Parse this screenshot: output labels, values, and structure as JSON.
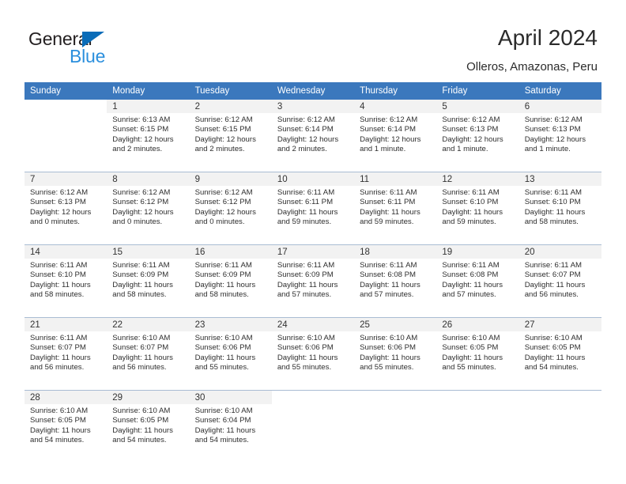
{
  "brand": {
    "name_dark": "General",
    "name_blue": "Blue",
    "triangle_color": "#0a6cb8",
    "blue_text_color": "#2b8fdd"
  },
  "header": {
    "title": "April 2024",
    "location": "Olleros, Amazonas, Peru"
  },
  "theme": {
    "header_row_bg": "#3b78bd",
    "header_row_text": "#ffffff",
    "daynum_band_bg": "#f2f2f2",
    "row_separator": "#a9bcd3"
  },
  "weekdays": [
    "Sunday",
    "Monday",
    "Tuesday",
    "Wednesday",
    "Thursday",
    "Friday",
    "Saturday"
  ],
  "labels": {
    "sunrise_prefix": "Sunrise:",
    "sunset_prefix": "Sunset:",
    "daylight_prefix": "Daylight:"
  },
  "weeks": [
    [
      {
        "day": "",
        "blank": true
      },
      {
        "day": "1",
        "sunrise": "Sunrise: 6:13 AM",
        "sunset": "Sunset: 6:15 PM",
        "daylight_line1": "Daylight: 12 hours",
        "daylight_line2": "and 2 minutes."
      },
      {
        "day": "2",
        "sunrise": "Sunrise: 6:12 AM",
        "sunset": "Sunset: 6:15 PM",
        "daylight_line1": "Daylight: 12 hours",
        "daylight_line2": "and 2 minutes."
      },
      {
        "day": "3",
        "sunrise": "Sunrise: 6:12 AM",
        "sunset": "Sunset: 6:14 PM",
        "daylight_line1": "Daylight: 12 hours",
        "daylight_line2": "and 2 minutes."
      },
      {
        "day": "4",
        "sunrise": "Sunrise: 6:12 AM",
        "sunset": "Sunset: 6:14 PM",
        "daylight_line1": "Daylight: 12 hours",
        "daylight_line2": "and 1 minute."
      },
      {
        "day": "5",
        "sunrise": "Sunrise: 6:12 AM",
        "sunset": "Sunset: 6:13 PM",
        "daylight_line1": "Daylight: 12 hours",
        "daylight_line2": "and 1 minute."
      },
      {
        "day": "6",
        "sunrise": "Sunrise: 6:12 AM",
        "sunset": "Sunset: 6:13 PM",
        "daylight_line1": "Daylight: 12 hours",
        "daylight_line2": "and 1 minute."
      }
    ],
    [
      {
        "day": "7",
        "sunrise": "Sunrise: 6:12 AM",
        "sunset": "Sunset: 6:13 PM",
        "daylight_line1": "Daylight: 12 hours",
        "daylight_line2": "and 0 minutes."
      },
      {
        "day": "8",
        "sunrise": "Sunrise: 6:12 AM",
        "sunset": "Sunset: 6:12 PM",
        "daylight_line1": "Daylight: 12 hours",
        "daylight_line2": "and 0 minutes."
      },
      {
        "day": "9",
        "sunrise": "Sunrise: 6:12 AM",
        "sunset": "Sunset: 6:12 PM",
        "daylight_line1": "Daylight: 12 hours",
        "daylight_line2": "and 0 minutes."
      },
      {
        "day": "10",
        "sunrise": "Sunrise: 6:11 AM",
        "sunset": "Sunset: 6:11 PM",
        "daylight_line1": "Daylight: 11 hours",
        "daylight_line2": "and 59 minutes."
      },
      {
        "day": "11",
        "sunrise": "Sunrise: 6:11 AM",
        "sunset": "Sunset: 6:11 PM",
        "daylight_line1": "Daylight: 11 hours",
        "daylight_line2": "and 59 minutes."
      },
      {
        "day": "12",
        "sunrise": "Sunrise: 6:11 AM",
        "sunset": "Sunset: 6:10 PM",
        "daylight_line1": "Daylight: 11 hours",
        "daylight_line2": "and 59 minutes."
      },
      {
        "day": "13",
        "sunrise": "Sunrise: 6:11 AM",
        "sunset": "Sunset: 6:10 PM",
        "daylight_line1": "Daylight: 11 hours",
        "daylight_line2": "and 58 minutes."
      }
    ],
    [
      {
        "day": "14",
        "sunrise": "Sunrise: 6:11 AM",
        "sunset": "Sunset: 6:10 PM",
        "daylight_line1": "Daylight: 11 hours",
        "daylight_line2": "and 58 minutes."
      },
      {
        "day": "15",
        "sunrise": "Sunrise: 6:11 AM",
        "sunset": "Sunset: 6:09 PM",
        "daylight_line1": "Daylight: 11 hours",
        "daylight_line2": "and 58 minutes."
      },
      {
        "day": "16",
        "sunrise": "Sunrise: 6:11 AM",
        "sunset": "Sunset: 6:09 PM",
        "daylight_line1": "Daylight: 11 hours",
        "daylight_line2": "and 58 minutes."
      },
      {
        "day": "17",
        "sunrise": "Sunrise: 6:11 AM",
        "sunset": "Sunset: 6:09 PM",
        "daylight_line1": "Daylight: 11 hours",
        "daylight_line2": "and 57 minutes."
      },
      {
        "day": "18",
        "sunrise": "Sunrise: 6:11 AM",
        "sunset": "Sunset: 6:08 PM",
        "daylight_line1": "Daylight: 11 hours",
        "daylight_line2": "and 57 minutes."
      },
      {
        "day": "19",
        "sunrise": "Sunrise: 6:11 AM",
        "sunset": "Sunset: 6:08 PM",
        "daylight_line1": "Daylight: 11 hours",
        "daylight_line2": "and 57 minutes."
      },
      {
        "day": "20",
        "sunrise": "Sunrise: 6:11 AM",
        "sunset": "Sunset: 6:07 PM",
        "daylight_line1": "Daylight: 11 hours",
        "daylight_line2": "and 56 minutes."
      }
    ],
    [
      {
        "day": "21",
        "sunrise": "Sunrise: 6:11 AM",
        "sunset": "Sunset: 6:07 PM",
        "daylight_line1": "Daylight: 11 hours",
        "daylight_line2": "and 56 minutes."
      },
      {
        "day": "22",
        "sunrise": "Sunrise: 6:10 AM",
        "sunset": "Sunset: 6:07 PM",
        "daylight_line1": "Daylight: 11 hours",
        "daylight_line2": "and 56 minutes."
      },
      {
        "day": "23",
        "sunrise": "Sunrise: 6:10 AM",
        "sunset": "Sunset: 6:06 PM",
        "daylight_line1": "Daylight: 11 hours",
        "daylight_line2": "and 55 minutes."
      },
      {
        "day": "24",
        "sunrise": "Sunrise: 6:10 AM",
        "sunset": "Sunset: 6:06 PM",
        "daylight_line1": "Daylight: 11 hours",
        "daylight_line2": "and 55 minutes."
      },
      {
        "day": "25",
        "sunrise": "Sunrise: 6:10 AM",
        "sunset": "Sunset: 6:06 PM",
        "daylight_line1": "Daylight: 11 hours",
        "daylight_line2": "and 55 minutes."
      },
      {
        "day": "26",
        "sunrise": "Sunrise: 6:10 AM",
        "sunset": "Sunset: 6:05 PM",
        "daylight_line1": "Daylight: 11 hours",
        "daylight_line2": "and 55 minutes."
      },
      {
        "day": "27",
        "sunrise": "Sunrise: 6:10 AM",
        "sunset": "Sunset: 6:05 PM",
        "daylight_line1": "Daylight: 11 hours",
        "daylight_line2": "and 54 minutes."
      }
    ],
    [
      {
        "day": "28",
        "sunrise": "Sunrise: 6:10 AM",
        "sunset": "Sunset: 6:05 PM",
        "daylight_line1": "Daylight: 11 hours",
        "daylight_line2": "and 54 minutes."
      },
      {
        "day": "29",
        "sunrise": "Sunrise: 6:10 AM",
        "sunset": "Sunset: 6:05 PM",
        "daylight_line1": "Daylight: 11 hours",
        "daylight_line2": "and 54 minutes."
      },
      {
        "day": "30",
        "sunrise": "Sunrise: 6:10 AM",
        "sunset": "Sunset: 6:04 PM",
        "daylight_line1": "Daylight: 11 hours",
        "daylight_line2": "and 54 minutes."
      },
      {
        "day": "",
        "blank": true
      },
      {
        "day": "",
        "blank": true
      },
      {
        "day": "",
        "blank": true
      },
      {
        "day": "",
        "blank": true
      }
    ]
  ]
}
